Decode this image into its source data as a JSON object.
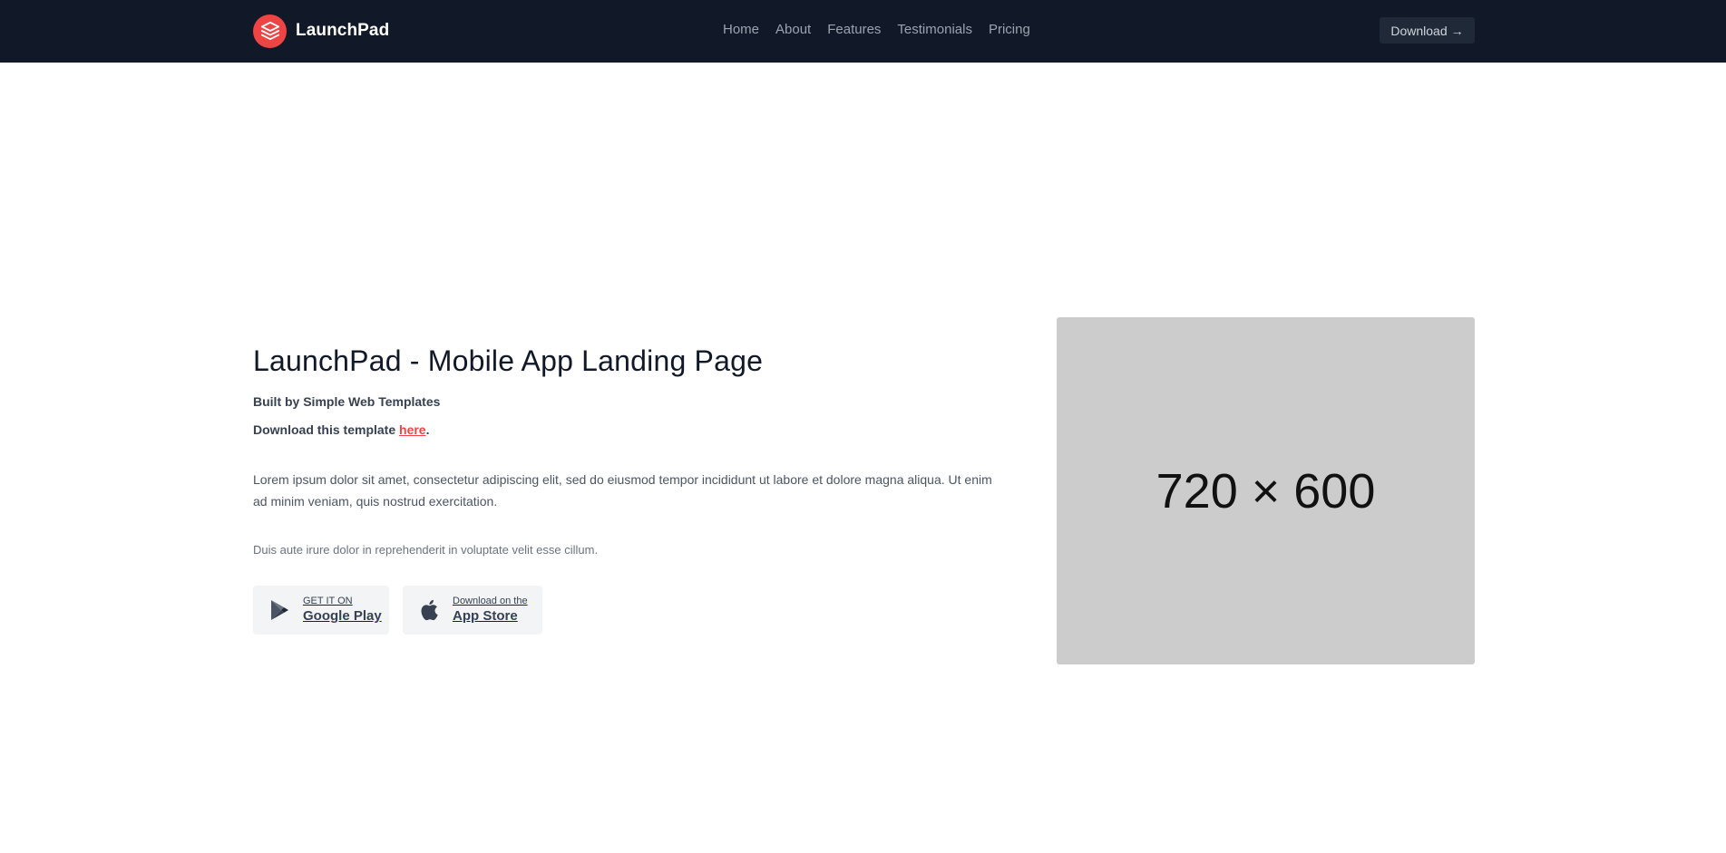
{
  "header": {
    "brand_name": "LaunchPad",
    "nav": [
      "Home",
      "About",
      "Features",
      "Testimonials",
      "Pricing"
    ],
    "download_label": "Download",
    "download_arrow": "→"
  },
  "hero": {
    "title": "LaunchPad - Mobile App Landing Page",
    "subtitle": "Built by Simple Web Templates",
    "download_prefix": "Download this template ",
    "download_link": "here",
    "download_suffix": ".",
    "lorem": "Lorem ipsum dolor sit amet, consectetur adipiscing elit, sed do eiusmod tempor incididunt ut labore et dolore magna aliqua. Ut enim ad minim veniam, quis nostrud exercitation.",
    "duis": "Duis aute irure dolor in reprehenderit in voluptate velit esse cillum.",
    "google": {
      "small": "GET IT ON",
      "big": "Google Play",
      "icon": "google-play-icon"
    },
    "apple": {
      "small": "Download on the",
      "big": "App Store",
      "icon": "apple-icon"
    },
    "image_placeholder": "720 × 600"
  },
  "colors": {
    "header_bg": "#111827",
    "accent": "#ef4444",
    "image_bg": "#cccccc"
  }
}
